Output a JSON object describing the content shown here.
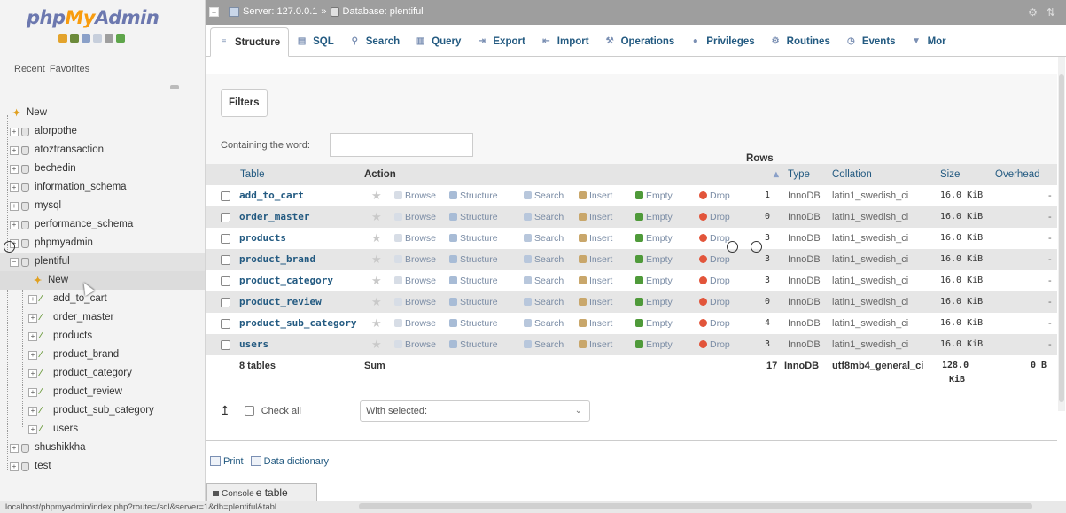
{
  "nav": {
    "logo": {
      "php": "php",
      "my": "My",
      "admin": "Admin"
    },
    "recent_label": "Recent",
    "favorites_label": "Favorites",
    "tree": [
      {
        "kind": "newtop",
        "label": "New"
      },
      {
        "kind": "db",
        "label": "alorpothe"
      },
      {
        "kind": "db",
        "label": "atoztransaction"
      },
      {
        "kind": "db",
        "label": "bechedin"
      },
      {
        "kind": "db",
        "label": "information_schema"
      },
      {
        "kind": "db",
        "label": "mysql"
      },
      {
        "kind": "db",
        "label": "performance_schema"
      },
      {
        "kind": "db",
        "label": "phpmyadmin"
      },
      {
        "kind": "db-open",
        "label": "plentiful"
      },
      {
        "kind": "newsub",
        "label": "New"
      },
      {
        "kind": "tbl",
        "label": "add_to_cart"
      },
      {
        "kind": "tbl",
        "label": "order_master"
      },
      {
        "kind": "tbl",
        "label": "products"
      },
      {
        "kind": "tbl",
        "label": "product_brand"
      },
      {
        "kind": "tbl",
        "label": "product_category"
      },
      {
        "kind": "tbl",
        "label": "product_review"
      },
      {
        "kind": "tbl",
        "label": "product_sub_category"
      },
      {
        "kind": "tbl",
        "label": "users"
      },
      {
        "kind": "db",
        "label": "shushikkha"
      },
      {
        "kind": "db",
        "label": "test"
      }
    ]
  },
  "topbar": {
    "server": "Server: 127.0.0.1",
    "sep": "»",
    "database": "Database: plentiful"
  },
  "tabs": [
    {
      "label": "Structure",
      "icon": "structure-icon",
      "glyph": "≡",
      "active": true
    },
    {
      "label": "SQL",
      "icon": "sql-icon",
      "glyph": "▤"
    },
    {
      "label": "Search",
      "icon": "search-icon",
      "glyph": "⚲"
    },
    {
      "label": "Query",
      "icon": "query-icon",
      "glyph": "▥"
    },
    {
      "label": "Export",
      "icon": "export-icon",
      "glyph": "⇥"
    },
    {
      "label": "Import",
      "icon": "import-icon",
      "glyph": "⇤"
    },
    {
      "label": "Operations",
      "icon": "operations-icon",
      "glyph": "⚒"
    },
    {
      "label": "Privileges",
      "icon": "privileges-icon",
      "glyph": "●"
    },
    {
      "label": "Routines",
      "icon": "routines-icon",
      "glyph": "⚙"
    },
    {
      "label": "Events",
      "icon": "events-icon",
      "glyph": "◷"
    },
    {
      "label": "Mor",
      "icon": "more-icon",
      "glyph": "▼"
    }
  ],
  "filters": {
    "legend": "Filters",
    "label": "Containing the word:",
    "value": ""
  },
  "table": {
    "headers": {
      "table": "Table",
      "action": "Action",
      "rows": "Rows",
      "type": "Type",
      "collation": "Collation",
      "size": "Size",
      "overhead": "Overhead"
    },
    "actions": [
      "Browse",
      "Structure",
      "Search",
      "Insert",
      "Empty",
      "Drop"
    ],
    "rows": [
      {
        "name": "add_to_cart",
        "rows": "1",
        "type": "InnoDB",
        "collation": "latin1_swedish_ci",
        "size": "16.0 KiB",
        "overhead": "-"
      },
      {
        "name": "order_master",
        "rows": "0",
        "type": "InnoDB",
        "collation": "latin1_swedish_ci",
        "size": "16.0 KiB",
        "overhead": "-"
      },
      {
        "name": "products",
        "rows": "3",
        "type": "InnoDB",
        "collation": "latin1_swedish_ci",
        "size": "16.0 KiB",
        "overhead": "-"
      },
      {
        "name": "product_brand",
        "rows": "3",
        "type": "InnoDB",
        "collation": "latin1_swedish_ci",
        "size": "16.0 KiB",
        "overhead": "-"
      },
      {
        "name": "product_category",
        "rows": "3",
        "type": "InnoDB",
        "collation": "latin1_swedish_ci",
        "size": "16.0 KiB",
        "overhead": "-"
      },
      {
        "name": "product_review",
        "rows": "0",
        "type": "InnoDB",
        "collation": "latin1_swedish_ci",
        "size": "16.0 KiB",
        "overhead": "-"
      },
      {
        "name": "product_sub_category",
        "rows": "4",
        "type": "InnoDB",
        "collation": "latin1_swedish_ci",
        "size": "16.0 KiB",
        "overhead": "-"
      },
      {
        "name": "users",
        "rows": "3",
        "type": "InnoDB",
        "collation": "latin1_swedish_ci",
        "size": "16.0 KiB",
        "overhead": "-"
      }
    ],
    "summary": {
      "count": "8 tables",
      "sum": "Sum",
      "rows": "17",
      "type": "InnoDB",
      "collation": "utf8mb4_general_ci",
      "size_value": "128.0",
      "size_unit": "KiB",
      "overhead": "0 B"
    }
  },
  "bulk": {
    "check_all": "Check all",
    "with_selected": "With selected:"
  },
  "footer_links": {
    "print": "Print",
    "data_dictionary": "Data dictionary"
  },
  "console": {
    "label": "Console",
    "overlay": "e table"
  },
  "statusbar": {
    "url": "localhost/phpmyadmin/index.php?route=/sql&server=1&db=plentiful&tabl..."
  },
  "colors": {
    "link": "#235a81",
    "topbar": "#9e9e9e",
    "drop": "#e2553b",
    "empty": "#4f9a3a"
  }
}
